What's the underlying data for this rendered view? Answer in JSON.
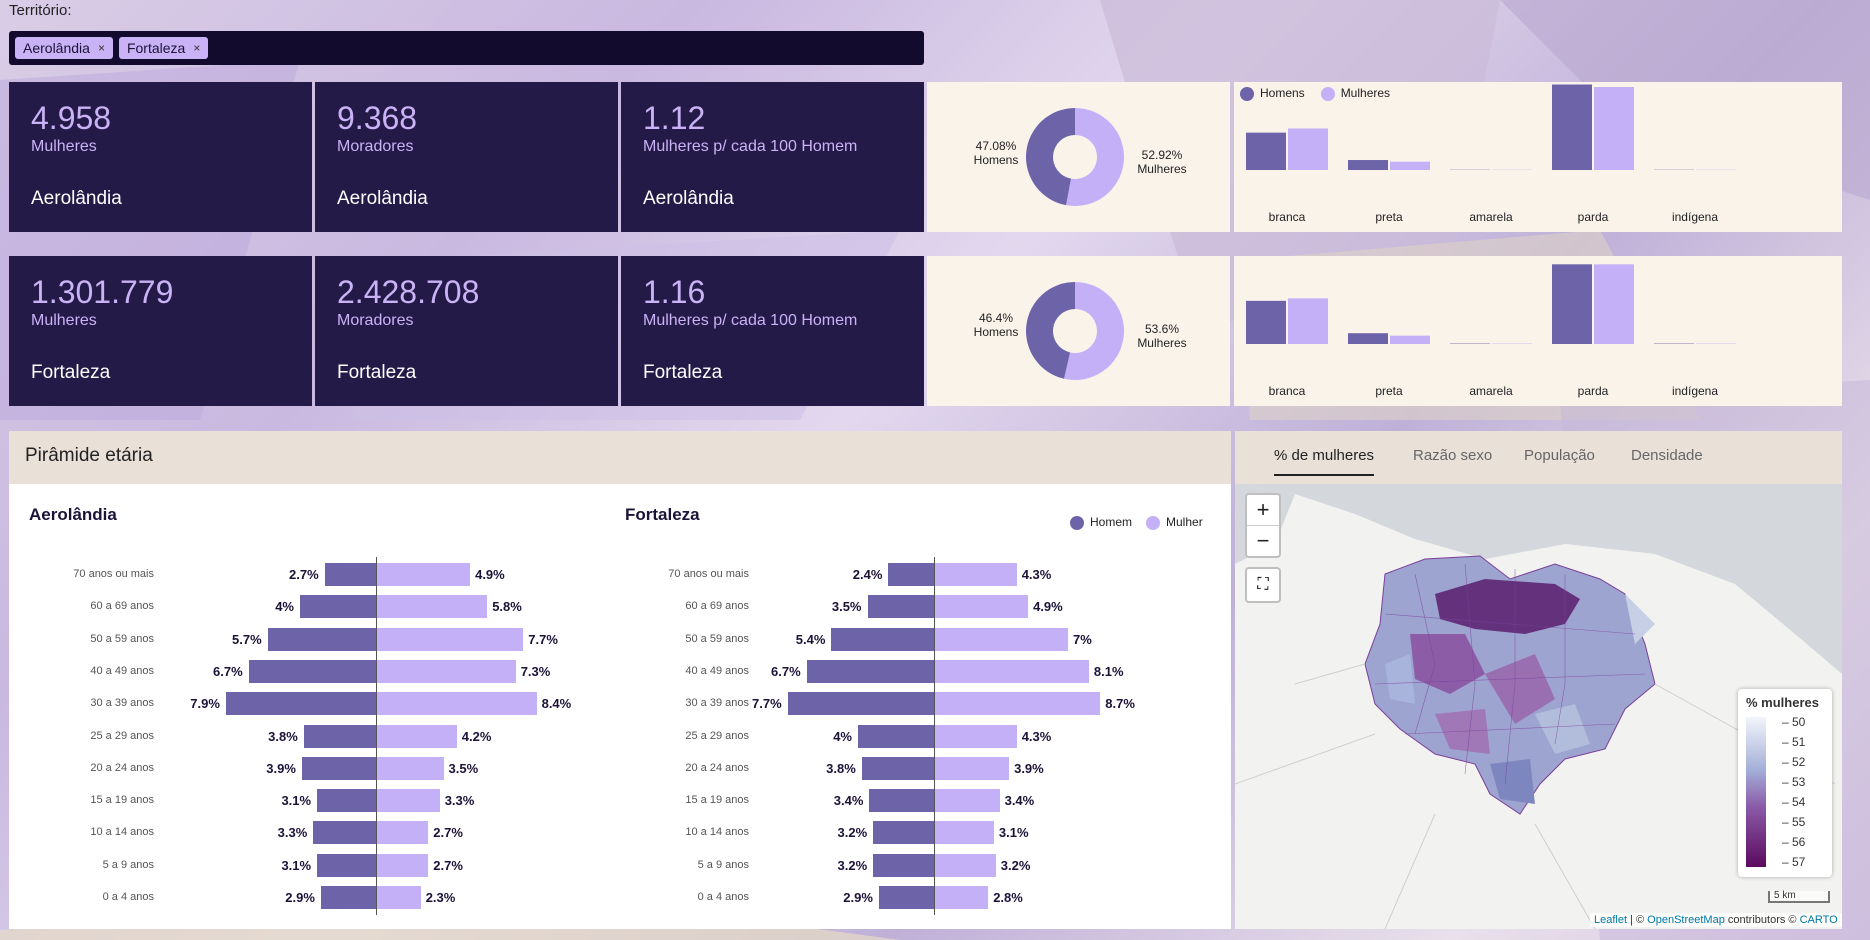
{
  "filter": {
    "label": "Território:",
    "chips": [
      "Aerolândia",
      "Fortaleza"
    ],
    "remove_glyph": "×"
  },
  "kpi_rows": [
    {
      "cards": [
        {
          "value": "4.958",
          "label": "Mulheres",
          "place": "Aerolândia"
        },
        {
          "value": "9.368",
          "label": "Moradores",
          "place": "Aerolândia"
        },
        {
          "value": "1.12",
          "label": "Mulheres p/ cada 100 Homem",
          "place": "Aerolândia"
        }
      ],
      "donut": {
        "homens_pct": "47.08%",
        "homens_label": "Homens",
        "mulheres_pct": "52.92%",
        "mulheres_label": "Mulheres",
        "mulheres_frac": 0.5292
      }
    },
    {
      "cards": [
        {
          "value": "1.301.779",
          "label": "Mulheres",
          "place": "Fortaleza"
        },
        {
          "value": "2.428.708",
          "label": "Moradores",
          "place": "Fortaleza"
        },
        {
          "value": "1.16",
          "label": "Mulheres p/ cada 100 Homem",
          "place": "Fortaleza"
        }
      ],
      "donut": {
        "homens_pct": "46.4%",
        "homens_label": "Homens",
        "mulheres_pct": "53.6%",
        "mulheres_label": "Mulheres",
        "mulheres_frac": 0.536
      }
    }
  ],
  "race_legend": {
    "homens": "Homens",
    "mulheres": "Mulheres"
  },
  "colors": {
    "homem": "#6c63a8",
    "mulher": "#c4b0f7",
    "dark": "#241a47"
  },
  "race_charts": [
    {
      "type": "bar",
      "categories": [
        "branca",
        "preta",
        "amarela",
        "parda",
        "indígena"
      ],
      "series": [
        {
          "name": "Homens",
          "values": [
            45,
            12,
            0.3,
            103,
            0.3
          ]
        },
        {
          "name": "Mulheres",
          "values": [
            50,
            10,
            0.3,
            100,
            0.3
          ]
        }
      ]
    },
    {
      "type": "bar",
      "categories": [
        "branca",
        "preta",
        "amarela",
        "parda",
        "indígena"
      ],
      "series": [
        {
          "name": "Homens",
          "values": [
            52,
            13,
            0.5,
            96,
            0.5
          ]
        },
        {
          "name": "Mulheres",
          "values": [
            55,
            10,
            0.5,
            96,
            0.5
          ]
        }
      ]
    }
  ],
  "pyramid": {
    "title": "Pirâmide etária",
    "legend": {
      "homem": "Homem",
      "mulher": "Mulher"
    },
    "ages": [
      "70 anos ou mais",
      "60 a 69 anos",
      "50 a 59 anos",
      "40 a 49 anos",
      "30 a 39 anos",
      "25 a 29 anos",
      "20 a 24 anos",
      "15 a 19 anos",
      "10 a 14 anos",
      "5 a 9 anos",
      "0 a 4 anos"
    ],
    "charts": [
      {
        "place": "Aerolândia",
        "homem": [
          2.7,
          4,
          5.7,
          6.7,
          7.9,
          3.8,
          3.9,
          3.1,
          3.3,
          3.1,
          2.9
        ],
        "mulher": [
          4.9,
          5.8,
          7.7,
          7.3,
          8.4,
          4.2,
          3.5,
          3.3,
          2.7,
          2.7,
          2.3
        ],
        "homem_labels": [
          "2.7%",
          "4%",
          "5.7%",
          "6.7%",
          "7.9%",
          "3.8%",
          "3.9%",
          "3.1%",
          "3.3%",
          "3.1%",
          "2.9%"
        ],
        "mulher_labels": [
          "4.9%",
          "5.8%",
          "7.7%",
          "7.3%",
          "8.4%",
          "4.2%",
          "3.5%",
          "3.3%",
          "2.7%",
          "2.7%",
          "2.3%"
        ]
      },
      {
        "place": "Fortaleza",
        "homem": [
          2.4,
          3.5,
          5.4,
          6.7,
          7.7,
          4,
          3.8,
          3.4,
          3.2,
          3.2,
          2.9
        ],
        "mulher": [
          4.3,
          4.9,
          7,
          8.1,
          8.7,
          4.3,
          3.9,
          3.4,
          3.1,
          3.2,
          2.8
        ],
        "homem_labels": [
          "2.4%",
          "3.5%",
          "5.4%",
          "6.7%",
          "7.7%",
          "4%",
          "3.8%",
          "3.4%",
          "3.2%",
          "3.2%",
          "2.9%"
        ],
        "mulher_labels": [
          "4.3%",
          "4.9%",
          "7%",
          "8.1%",
          "8.7%",
          "4.3%",
          "3.9%",
          "3.4%",
          "3.1%",
          "3.2%",
          "2.8%"
        ]
      }
    ]
  },
  "map": {
    "tabs": [
      "% de mulheres",
      "Razão sexo",
      "População",
      "Densidade"
    ],
    "active_tab": 0,
    "zoom_in": "+",
    "zoom_out": "−",
    "fullscreen": "⛶",
    "legend_title": "% mulheres",
    "legend_ticks": [
      "50",
      "51",
      "52",
      "53",
      "54",
      "55",
      "56",
      "57"
    ],
    "scale": "5 km",
    "attribution": {
      "leaflet": "Leaflet",
      "sep": " | © ",
      "osm": "OpenStreetMap",
      "contrib": " contributors © ",
      "carto": "CARTO"
    }
  }
}
